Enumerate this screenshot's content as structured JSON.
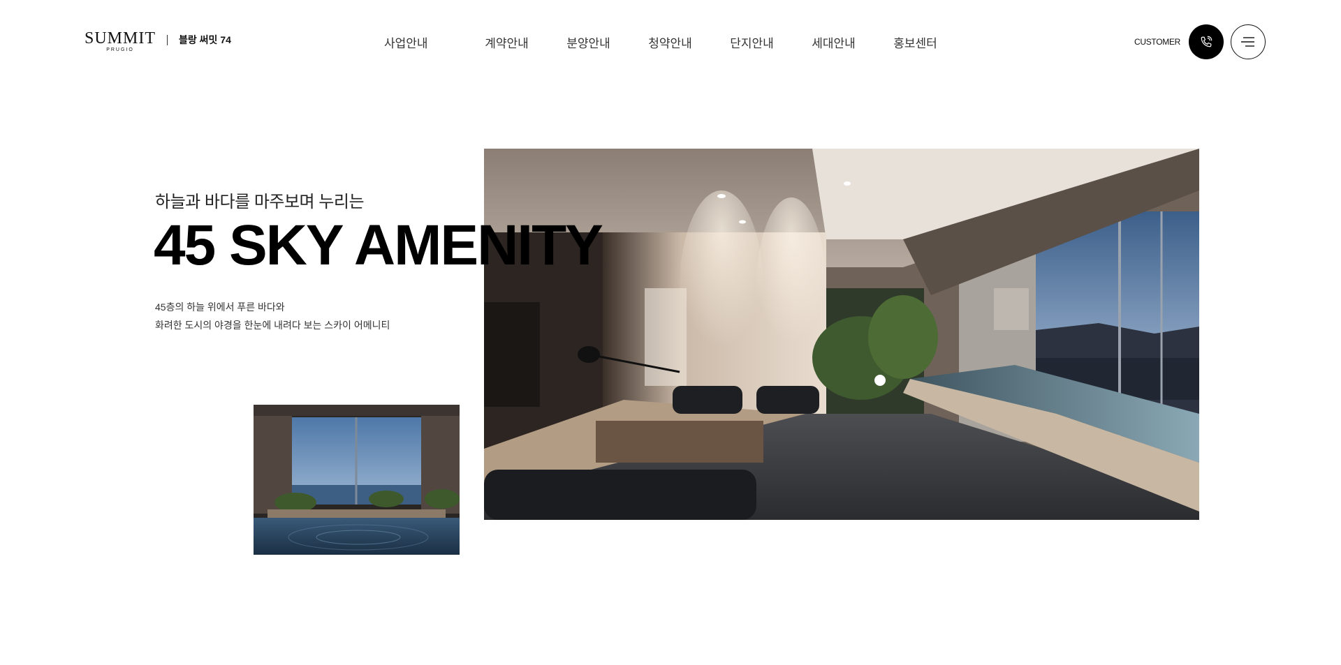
{
  "header": {
    "logo_word": "SUMMIT",
    "logo_sub": "PRUGIO",
    "site_name": "블랑 써밋 74",
    "nav": [
      "사업안내",
      "계약안내",
      "분양안내",
      "청약안내",
      "단지안내",
      "세대안내",
      "홍보센터"
    ],
    "customer_label": "CUSTOMER",
    "call_icon": "phone-icon",
    "menu_icon": "hamburger-menu-icon"
  },
  "hero": {
    "eyebrow": "하늘과 바다를 마주보며 누리는",
    "headline": "45 SKY AMENITY",
    "desc_lines": [
      "45층의 하늘 위에서 푸른 바다와",
      "화려한 도시의 야경을 한눈에 내려다 보는 스카이 어메니티"
    ]
  },
  "colors": {
    "text": "#111111",
    "background": "#ffffff",
    "call_button": "#000000"
  }
}
